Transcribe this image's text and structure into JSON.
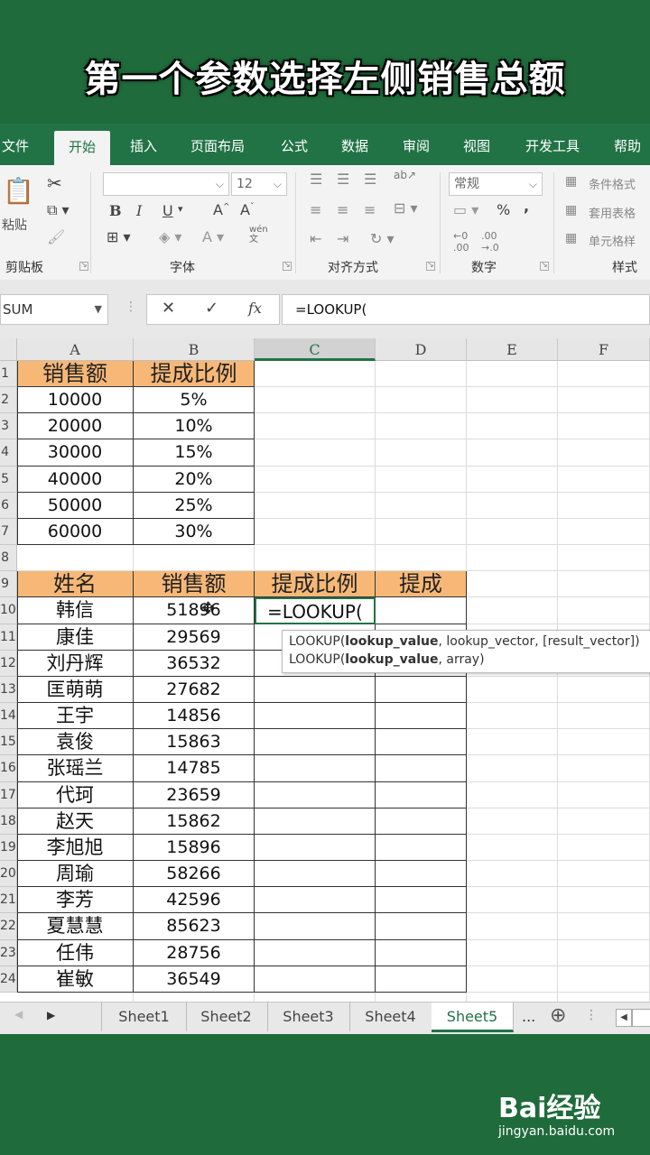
{
  "caption": "第一个参数选择左侧销售总额",
  "ribbon_tabs": [
    "文件",
    "开始",
    "插入",
    "页面布局",
    "公式",
    "数据",
    "审阅",
    "视图",
    "开发工具",
    "帮助"
  ],
  "ribbon": {
    "clipboard_label": "剪贴板",
    "paste_label": "粘贴",
    "font_label": "字体",
    "font_size": "12",
    "bold": "B",
    "italic": "I",
    "underline": "U",
    "wen": "wén\n文",
    "align_label": "对齐方式",
    "number_label": "数字",
    "number_format": "常规",
    "styles_label": "样式",
    "cond_format": "条件格式",
    "table_format": "套用表格",
    "cell_style": "单元格样",
    "percent": "%",
    "comma": ","
  },
  "formula_bar": {
    "name_box": "SUM",
    "cancel": "✕",
    "enter": "✓",
    "fx": "fx",
    "formula": "=LOOKUP("
  },
  "columns": [
    "A",
    "B",
    "C",
    "D",
    "E",
    "F"
  ],
  "row_numbers": [
    "1",
    "2",
    "3",
    "4",
    "5",
    "6",
    "7",
    "8",
    "9",
    "10",
    "11",
    "12",
    "13",
    "14",
    "15",
    "16",
    "17",
    "18",
    "19",
    "20",
    "21",
    "22",
    "23",
    "24"
  ],
  "rate_table": {
    "headers": [
      "销售额",
      "提成比例"
    ],
    "rows": [
      [
        "10000",
        "5%"
      ],
      [
        "20000",
        "10%"
      ],
      [
        "30000",
        "15%"
      ],
      [
        "40000",
        "20%"
      ],
      [
        "50000",
        "25%"
      ],
      [
        "60000",
        "30%"
      ]
    ]
  },
  "sales_table": {
    "headers": [
      "姓名",
      "销售额",
      "提成比例",
      "提成"
    ],
    "rows": [
      [
        "韩信",
        "51896"
      ],
      [
        "康佳",
        "29569"
      ],
      [
        "刘丹辉",
        "36532"
      ],
      [
        "匡萌萌",
        "27682"
      ],
      [
        "王宇",
        "14856"
      ],
      [
        "袁俊",
        "15863"
      ],
      [
        "张瑶兰",
        "14785"
      ],
      [
        "代珂",
        "23659"
      ],
      [
        "赵天",
        "15862"
      ],
      [
        "李旭旭",
        "15896"
      ],
      [
        "周瑜",
        "58266"
      ],
      [
        "李芳",
        "42596"
      ],
      [
        "夏慧慧",
        "85623"
      ],
      [
        "任伟",
        "28756"
      ],
      [
        "崔敏",
        "36549"
      ]
    ]
  },
  "editing_cell": "=LOOKUP(",
  "tooltip": {
    "line1_name": "LOOKUP(",
    "line1_bold": "lookup_value",
    "line1_rest": ", lookup_vector, [result_vector])",
    "line2_name": "LOOKUP(",
    "line2_bold": "lookup_value",
    "line2_rest": ", array)"
  },
  "sheet_tabs": [
    "Sheet1",
    "Sheet2",
    "Sheet3",
    "Sheet4",
    "Sheet5"
  ],
  "sheet_more": "...",
  "active_sheet": "Sheet5",
  "watermark": {
    "brand": "Bai经验",
    "url": "jingyan.baidu.com"
  },
  "colors": {
    "excel_green": "#217346",
    "header_fill": "#f7b877",
    "background": "#1f6b3b"
  }
}
